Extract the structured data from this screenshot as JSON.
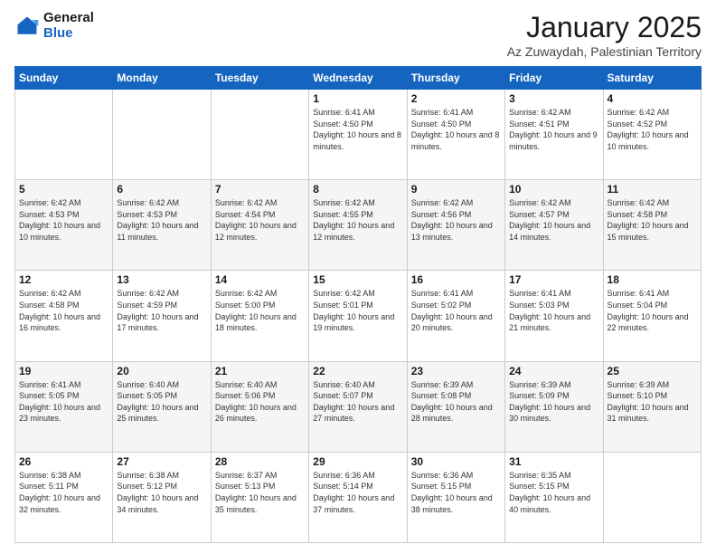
{
  "header": {
    "logo_general": "General",
    "logo_blue": "Blue",
    "month_title": "January 2025",
    "subtitle": "Az Zuwaydah, Palestinian Territory"
  },
  "weekdays": [
    "Sunday",
    "Monday",
    "Tuesday",
    "Wednesday",
    "Thursday",
    "Friday",
    "Saturday"
  ],
  "weeks": [
    [
      {
        "day": "",
        "sunrise": "",
        "sunset": "",
        "daylight": ""
      },
      {
        "day": "",
        "sunrise": "",
        "sunset": "",
        "daylight": ""
      },
      {
        "day": "",
        "sunrise": "",
        "sunset": "",
        "daylight": ""
      },
      {
        "day": "1",
        "sunrise": "Sunrise: 6:41 AM",
        "sunset": "Sunset: 4:50 PM",
        "daylight": "Daylight: 10 hours and 8 minutes."
      },
      {
        "day": "2",
        "sunrise": "Sunrise: 6:41 AM",
        "sunset": "Sunset: 4:50 PM",
        "daylight": "Daylight: 10 hours and 8 minutes."
      },
      {
        "day": "3",
        "sunrise": "Sunrise: 6:42 AM",
        "sunset": "Sunset: 4:51 PM",
        "daylight": "Daylight: 10 hours and 9 minutes."
      },
      {
        "day": "4",
        "sunrise": "Sunrise: 6:42 AM",
        "sunset": "Sunset: 4:52 PM",
        "daylight": "Daylight: 10 hours and 10 minutes."
      }
    ],
    [
      {
        "day": "5",
        "sunrise": "Sunrise: 6:42 AM",
        "sunset": "Sunset: 4:53 PM",
        "daylight": "Daylight: 10 hours and 10 minutes."
      },
      {
        "day": "6",
        "sunrise": "Sunrise: 6:42 AM",
        "sunset": "Sunset: 4:53 PM",
        "daylight": "Daylight: 10 hours and 11 minutes."
      },
      {
        "day": "7",
        "sunrise": "Sunrise: 6:42 AM",
        "sunset": "Sunset: 4:54 PM",
        "daylight": "Daylight: 10 hours and 12 minutes."
      },
      {
        "day": "8",
        "sunrise": "Sunrise: 6:42 AM",
        "sunset": "Sunset: 4:55 PM",
        "daylight": "Daylight: 10 hours and 12 minutes."
      },
      {
        "day": "9",
        "sunrise": "Sunrise: 6:42 AM",
        "sunset": "Sunset: 4:56 PM",
        "daylight": "Daylight: 10 hours and 13 minutes."
      },
      {
        "day": "10",
        "sunrise": "Sunrise: 6:42 AM",
        "sunset": "Sunset: 4:57 PM",
        "daylight": "Daylight: 10 hours and 14 minutes."
      },
      {
        "day": "11",
        "sunrise": "Sunrise: 6:42 AM",
        "sunset": "Sunset: 4:58 PM",
        "daylight": "Daylight: 10 hours and 15 minutes."
      }
    ],
    [
      {
        "day": "12",
        "sunrise": "Sunrise: 6:42 AM",
        "sunset": "Sunset: 4:58 PM",
        "daylight": "Daylight: 10 hours and 16 minutes."
      },
      {
        "day": "13",
        "sunrise": "Sunrise: 6:42 AM",
        "sunset": "Sunset: 4:59 PM",
        "daylight": "Daylight: 10 hours and 17 minutes."
      },
      {
        "day": "14",
        "sunrise": "Sunrise: 6:42 AM",
        "sunset": "Sunset: 5:00 PM",
        "daylight": "Daylight: 10 hours and 18 minutes."
      },
      {
        "day": "15",
        "sunrise": "Sunrise: 6:42 AM",
        "sunset": "Sunset: 5:01 PM",
        "daylight": "Daylight: 10 hours and 19 minutes."
      },
      {
        "day": "16",
        "sunrise": "Sunrise: 6:41 AM",
        "sunset": "Sunset: 5:02 PM",
        "daylight": "Daylight: 10 hours and 20 minutes."
      },
      {
        "day": "17",
        "sunrise": "Sunrise: 6:41 AM",
        "sunset": "Sunset: 5:03 PM",
        "daylight": "Daylight: 10 hours and 21 minutes."
      },
      {
        "day": "18",
        "sunrise": "Sunrise: 6:41 AM",
        "sunset": "Sunset: 5:04 PM",
        "daylight": "Daylight: 10 hours and 22 minutes."
      }
    ],
    [
      {
        "day": "19",
        "sunrise": "Sunrise: 6:41 AM",
        "sunset": "Sunset: 5:05 PM",
        "daylight": "Daylight: 10 hours and 23 minutes."
      },
      {
        "day": "20",
        "sunrise": "Sunrise: 6:40 AM",
        "sunset": "Sunset: 5:05 PM",
        "daylight": "Daylight: 10 hours and 25 minutes."
      },
      {
        "day": "21",
        "sunrise": "Sunrise: 6:40 AM",
        "sunset": "Sunset: 5:06 PM",
        "daylight": "Daylight: 10 hours and 26 minutes."
      },
      {
        "day": "22",
        "sunrise": "Sunrise: 6:40 AM",
        "sunset": "Sunset: 5:07 PM",
        "daylight": "Daylight: 10 hours and 27 minutes."
      },
      {
        "day": "23",
        "sunrise": "Sunrise: 6:39 AM",
        "sunset": "Sunset: 5:08 PM",
        "daylight": "Daylight: 10 hours and 28 minutes."
      },
      {
        "day": "24",
        "sunrise": "Sunrise: 6:39 AM",
        "sunset": "Sunset: 5:09 PM",
        "daylight": "Daylight: 10 hours and 30 minutes."
      },
      {
        "day": "25",
        "sunrise": "Sunrise: 6:39 AM",
        "sunset": "Sunset: 5:10 PM",
        "daylight": "Daylight: 10 hours and 31 minutes."
      }
    ],
    [
      {
        "day": "26",
        "sunrise": "Sunrise: 6:38 AM",
        "sunset": "Sunset: 5:11 PM",
        "daylight": "Daylight: 10 hours and 32 minutes."
      },
      {
        "day": "27",
        "sunrise": "Sunrise: 6:38 AM",
        "sunset": "Sunset: 5:12 PM",
        "daylight": "Daylight: 10 hours and 34 minutes."
      },
      {
        "day": "28",
        "sunrise": "Sunrise: 6:37 AM",
        "sunset": "Sunset: 5:13 PM",
        "daylight": "Daylight: 10 hours and 35 minutes."
      },
      {
        "day": "29",
        "sunrise": "Sunrise: 6:36 AM",
        "sunset": "Sunset: 5:14 PM",
        "daylight": "Daylight: 10 hours and 37 minutes."
      },
      {
        "day": "30",
        "sunrise": "Sunrise: 6:36 AM",
        "sunset": "Sunset: 5:15 PM",
        "daylight": "Daylight: 10 hours and 38 minutes."
      },
      {
        "day": "31",
        "sunrise": "Sunrise: 6:35 AM",
        "sunset": "Sunset: 5:15 PM",
        "daylight": "Daylight: 10 hours and 40 minutes."
      },
      {
        "day": "",
        "sunrise": "",
        "sunset": "",
        "daylight": ""
      }
    ]
  ]
}
